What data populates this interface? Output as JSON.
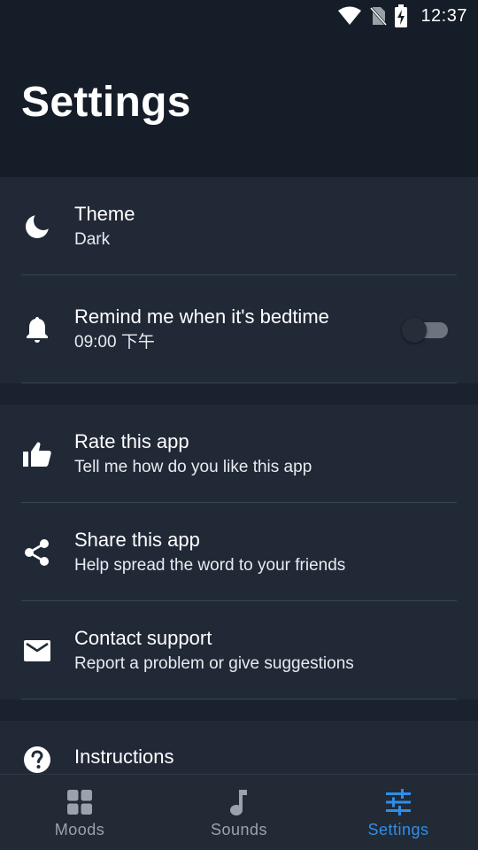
{
  "status_bar": {
    "time": "12:37",
    "icons": [
      "wifi-icon",
      "no-sim-icon",
      "battery-charging-icon"
    ]
  },
  "page": {
    "title": "Settings"
  },
  "settings": {
    "theme": {
      "title": "Theme",
      "subtitle": "Dark",
      "icon": "moon-icon"
    },
    "bedtime": {
      "title": "Remind me when it's bedtime",
      "subtitle": "09:00 下午",
      "icon": "bell-icon",
      "enabled": false
    },
    "rate": {
      "title": "Rate this app",
      "subtitle": "Tell me how do you like this app",
      "icon": "thumb-up-icon"
    },
    "share": {
      "title": "Share this app",
      "subtitle": "Help spread the word to your friends",
      "icon": "share-icon"
    },
    "contact": {
      "title": "Contact support",
      "subtitle": "Report a problem or give suggestions",
      "icon": "mail-icon"
    },
    "instructions": {
      "title": "Instructions",
      "icon": "help-icon"
    }
  },
  "bottom_nav": {
    "items": [
      {
        "label": "Moods",
        "icon": "grid-icon",
        "active": false
      },
      {
        "label": "Sounds",
        "icon": "music-note-icon",
        "active": false
      },
      {
        "label": "Settings",
        "icon": "sliders-icon",
        "active": true
      }
    ]
  },
  "colors": {
    "background": "#151d28",
    "card": "#212937",
    "accent": "#2f8ee8",
    "inactive": "#9aa2ad"
  }
}
